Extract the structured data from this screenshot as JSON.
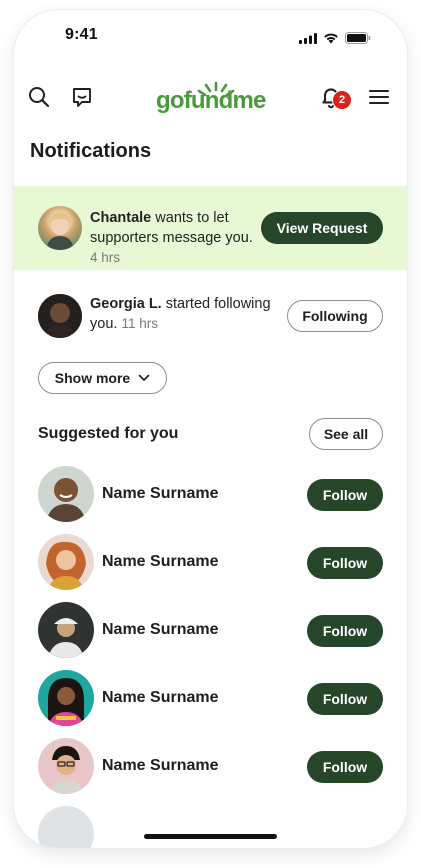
{
  "status": {
    "time": "9:41"
  },
  "header": {
    "logo": "gofundme",
    "notification_count": "2",
    "icons": [
      "search-icon",
      "message-icon",
      "bell-icon",
      "menu-icon"
    ]
  },
  "page": {
    "title": "Notifications"
  },
  "notifications": [
    {
      "name": "Chantale",
      "text": " wants to let supporters message you.",
      "time": "4 hrs",
      "action": "View Request"
    },
    {
      "name": "Georgia L.",
      "text": " started following you.",
      "time": "11 hrs",
      "action": "Following"
    }
  ],
  "show_more": {
    "label": "Show more"
  },
  "suggested": {
    "title": "Suggested for you",
    "see_all": "See all",
    "people": [
      {
        "name": "Name Surname",
        "action": "Follow"
      },
      {
        "name": "Name Surname",
        "action": "Follow"
      },
      {
        "name": "Name Surname",
        "action": "Follow"
      },
      {
        "name": "Name Surname",
        "action": "Follow"
      },
      {
        "name": "Name Surname",
        "action": "Follow"
      }
    ]
  },
  "colors": {
    "brand_green": "#4a9a3c",
    "button_dark": "#254628",
    "highlight_bg": "#e7f8d4",
    "badge_red": "#d9231c"
  }
}
